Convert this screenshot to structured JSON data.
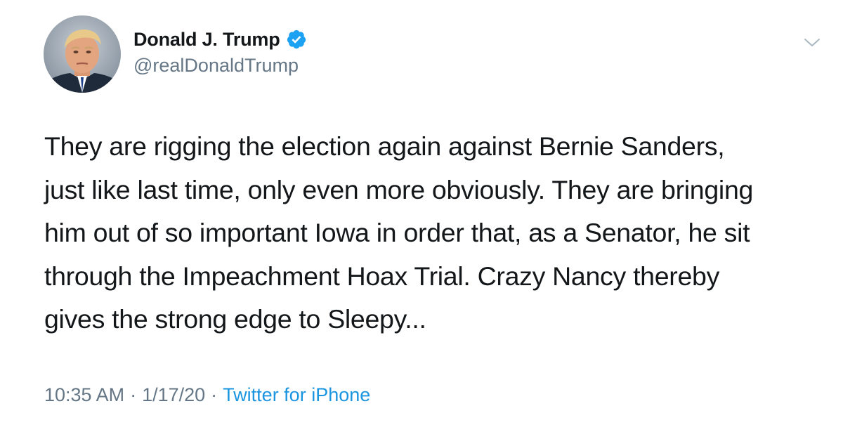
{
  "author": {
    "display_name": "Donald J. Trump",
    "handle": "@realDonaldTrump",
    "verified": true,
    "avatar_icon": "profile-photo-portrait",
    "verified_color": "#1da1f2"
  },
  "tweet": {
    "text": "They are rigging the election again against Bernie Sanders,\njust like last time, only even more obviously. They are bringing\nhim out of so important Iowa in order that, as a Senator, he sit\nthrough the Impeachment Hoax Trial. Crazy Nancy thereby\ngives the strong edge to Sleepy...",
    "time": "10:35 AM",
    "date": "1/17/20",
    "source": "Twitter for iPhone",
    "separator": "·"
  },
  "menu": {
    "icon": "chevron-down-icon"
  },
  "colors": {
    "text_primary": "#14171a",
    "text_secondary": "#657786",
    "link": "#1b95e0"
  }
}
